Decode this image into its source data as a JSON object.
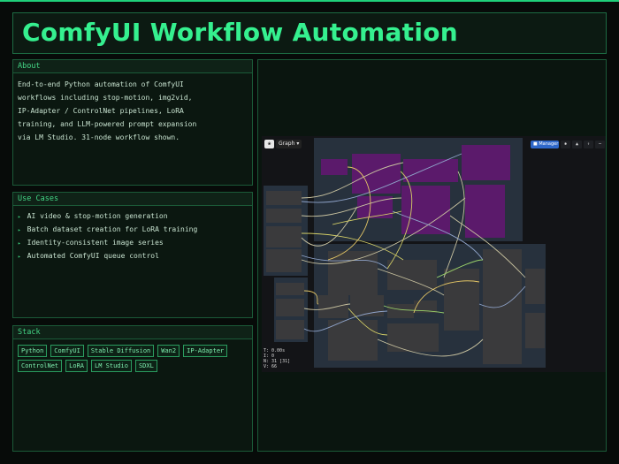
{
  "header": {
    "title": "ComfyUI Workflow Automation"
  },
  "about": {
    "heading": "About",
    "lines": [
      "End-to-end Python automation of ComfyUI",
      "workflows including stop-motion, img2vid,",
      "IP-Adapter / ControlNet pipelines, LoRA",
      "training, and LLM-powered prompt expansion",
      "via LM Studio. 31-node workflow shown."
    ]
  },
  "use_cases": {
    "heading": "Use Cases",
    "items": [
      "AI video & stop-motion generation",
      "Batch dataset creation for LoRA training",
      "Identity-consistent image series",
      "Automated ComfyUI queue control"
    ]
  },
  "stack": {
    "heading": "Stack",
    "tags": [
      "Python",
      "ComfyUI",
      "Stable Diffusion",
      "Wan2",
      "IP-Adapter",
      "ControlNet",
      "LoRA",
      "LM Studio",
      "SDXL"
    ]
  },
  "screenshot": {
    "toolbar": {
      "graph_label": "Graph",
      "manager_label": "Manager"
    },
    "stats": [
      "T: 0.00s",
      "I: 0",
      "N: 31 [31]",
      "V: 66"
    ],
    "colors": {
      "canvas": "#131417",
      "group": "#2b3644",
      "prompt_node": "#5b1a6b",
      "node": "#3a3a3c",
      "link": "#c9c3a0"
    }
  },
  "theme": {
    "accent": "#35f08f",
    "border": "#1b5a38",
    "background": "#070b09"
  }
}
